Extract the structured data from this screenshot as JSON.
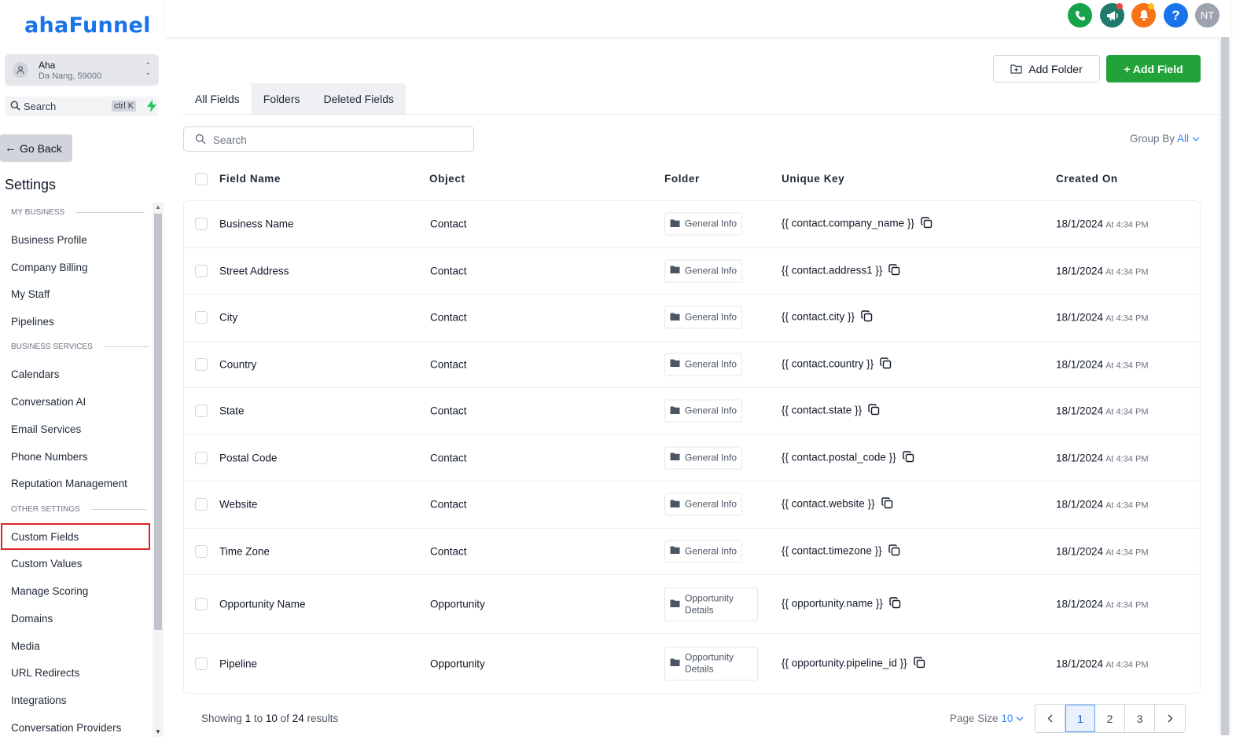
{
  "logo": "ahaFunnel",
  "account": {
    "name": "Aha",
    "location": "Da Nang, 59000"
  },
  "side_search": {
    "label": "Search",
    "shortcut": "ctrl K"
  },
  "go_back": "Go Back",
  "settings_title": "Settings",
  "sections": [
    {
      "title": "MY BUSINESS",
      "items": [
        "Business Profile",
        "Company Billing",
        "My Staff",
        "Pipelines"
      ]
    },
    {
      "title": "BUSINESS SERVICES",
      "items": [
        "Calendars",
        "Conversation AI",
        "Email Services",
        "Phone Numbers",
        "Reputation Management"
      ]
    },
    {
      "title": "OTHER SETTINGS",
      "items": [
        "Custom Fields",
        "Custom Values",
        "Manage Scoring",
        "Domains",
        "Media",
        "URL Redirects",
        "Integrations",
        "Conversation Providers"
      ]
    }
  ],
  "active_item": "Custom Fields",
  "topbar": {
    "icons": [
      {
        "name": "phone-icon",
        "color": "#16a34a"
      },
      {
        "name": "megaphone-icon",
        "color": "#1f7a6b"
      },
      {
        "name": "bell-icon",
        "color": "#f97316"
      },
      {
        "name": "help-icon",
        "color": "#1a73e8"
      },
      {
        "name": "avatar",
        "color": "#9ca3af"
      }
    ],
    "avatar_initials": "NT",
    "help_glyph": "?"
  },
  "buttons": {
    "add_folder": "Add Folder",
    "add_field": "+ Add Field"
  },
  "tabs": [
    "All Fields",
    "Folders",
    "Deleted Fields"
  ],
  "search": {
    "placeholder": "Search"
  },
  "group_by": {
    "label": "Group By",
    "value": "All"
  },
  "table": {
    "headers": [
      "Field Name",
      "Object",
      "Folder",
      "Unique Key",
      "Created On"
    ],
    "rows": [
      {
        "name": "Business Name",
        "object": "Contact",
        "folder": "General Info",
        "key": "{{ contact.company_name }}",
        "date": "18/1/2024",
        "time": "At 4:34 PM"
      },
      {
        "name": "Street Address",
        "object": "Contact",
        "folder": "General Info",
        "key": "{{ contact.address1 }}",
        "date": "18/1/2024",
        "time": "At 4:34 PM"
      },
      {
        "name": "City",
        "object": "Contact",
        "folder": "General Info",
        "key": "{{ contact.city }}",
        "date": "18/1/2024",
        "time": "At 4:34 PM"
      },
      {
        "name": "Country",
        "object": "Contact",
        "folder": "General Info",
        "key": "{{ contact.country }}",
        "date": "18/1/2024",
        "time": "At 4:34 PM"
      },
      {
        "name": "State",
        "object": "Contact",
        "folder": "General Info",
        "key": "{{ contact.state }}",
        "date": "18/1/2024",
        "time": "At 4:34 PM"
      },
      {
        "name": "Postal Code",
        "object": "Contact",
        "folder": "General Info",
        "key": "{{ contact.postal_code }}",
        "date": "18/1/2024",
        "time": "At 4:34 PM"
      },
      {
        "name": "Website",
        "object": "Contact",
        "folder": "General Info",
        "key": "{{ contact.website }}",
        "date": "18/1/2024",
        "time": "At 4:34 PM"
      },
      {
        "name": "Time Zone",
        "object": "Contact",
        "folder": "General Info",
        "key": "{{ contact.timezone }}",
        "date": "18/1/2024",
        "time": "At 4:34 PM"
      },
      {
        "name": "Opportunity Name",
        "object": "Opportunity",
        "folder": "Opportunity Details",
        "key": "{{ opportunity.name }}",
        "date": "18/1/2024",
        "time": "At 4:34 PM"
      },
      {
        "name": "Pipeline",
        "object": "Opportunity",
        "folder": "Opportunity Details",
        "key": "{{ opportunity.pipeline_id }}",
        "date": "18/1/2024",
        "time": "At 4:34 PM"
      }
    ]
  },
  "footer": {
    "showing_prefix": "Showing",
    "from": "1",
    "to_word": "to",
    "to": "10",
    "of_word": "of",
    "total": "24",
    "results_word": "results",
    "page_size_label": "Page Size",
    "page_size": "10",
    "pages": [
      "1",
      "2",
      "3"
    ],
    "current_page": "1"
  }
}
